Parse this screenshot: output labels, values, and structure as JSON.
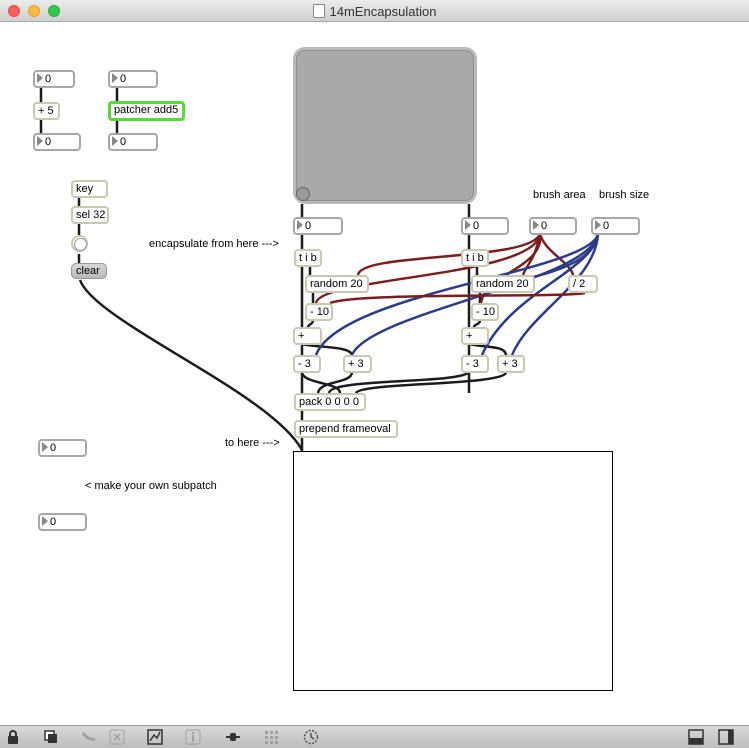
{
  "window": {
    "title": "14mEncapsulation"
  },
  "left_patch": {
    "num_top_a": "0",
    "plus5": "+ 5",
    "num_out_a": "0",
    "num_top_b": "0",
    "patcher": "patcher add5",
    "num_out_b": "0",
    "key": "key",
    "sel": "sel 32",
    "clear": "clear",
    "num_sub_in": "0",
    "num_sub_out": "0",
    "subpatch_comment": "< make your own subpatch"
  },
  "comments": {
    "encapsulate": "encapsulate from here --->",
    "to_here": "to here --->",
    "brush_area": "brush area",
    "brush_size": "brush size"
  },
  "main_patch": {
    "num_left": "0",
    "num_right": "0",
    "num_area": "0",
    "num_size": "0",
    "tib_left": "t i b",
    "tib_right": "t i b",
    "random_left": "random 20",
    "random_right": "random 20",
    "div2": "/ 2",
    "minus10_left": "- 10",
    "minus10_right": "- 10",
    "plus_left": "+",
    "plus_right": "+",
    "minus3_left": "- 3",
    "plus3_left": "+ 3",
    "minus3_right": "- 3",
    "plus3_right": "+ 3",
    "pack": "pack 0 0 0 0",
    "prepend": "prepend frameoval"
  },
  "colors": {
    "wire": "#1c1c1c",
    "wire_red": "#7a1f1f",
    "wire_blue": "#2d3b8a",
    "selected": "#5cd63d"
  },
  "toolbar_icons": [
    "lock-icon",
    "new-object-icon",
    "patch-cords-icon",
    "delete-icon",
    "inspector-icon",
    "info-icon",
    "slider-icon",
    "grid-icon",
    "clock-icon",
    "split-view-icon",
    "sidebar-icon"
  ]
}
